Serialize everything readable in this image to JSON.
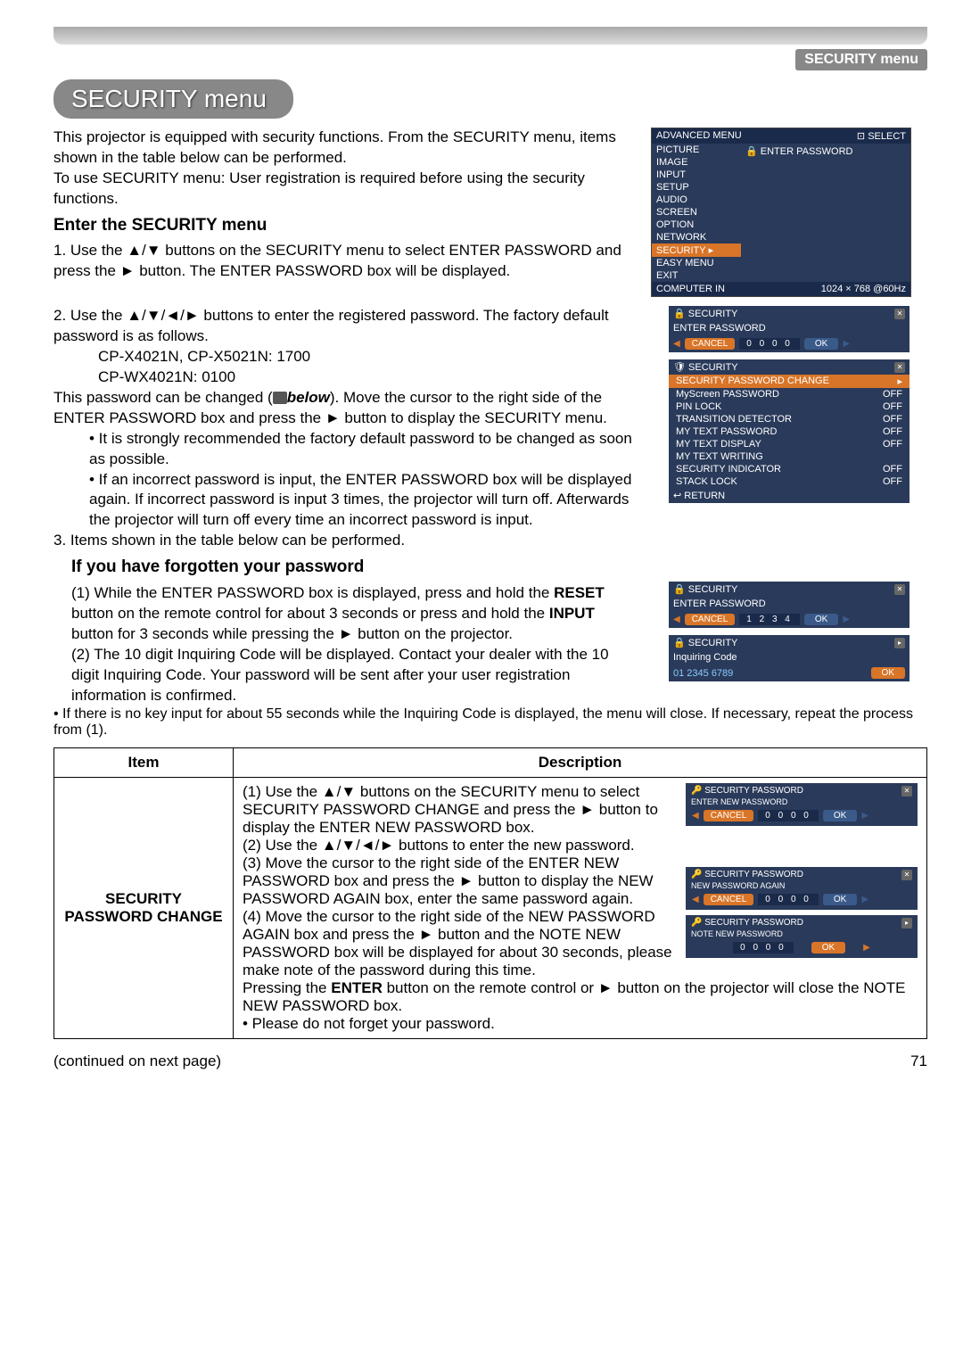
{
  "header": {
    "breadcrumb": "SECURITY menu",
    "title": "SECURITY menu"
  },
  "intro": {
    "p1": "This projector is equipped with security functions. From the SECURITY menu, items shown in the table below can be performed.",
    "p2": "To use SECURITY menu: User registration is required before using the security functions."
  },
  "enter": {
    "heading": "Enter the SECURITY menu",
    "step1": "1. Use the ▲/▼ buttons on the SECURITY menu to select ENTER PASSWORD and press the ► button. The ENTER PASSWORD box will be displayed.",
    "step2": "2. Use the ▲/▼/◄/► buttons to enter the registered password. The factory default password is as follows.",
    "pw1": "CP-X4021N, CP-X5021N: 1700",
    "pw2": "CP-WX4021N: 0100",
    "below_pre": " This password can be changed (",
    "below_link": "below",
    "below_post": "). Move the cursor to the right side of the ENTER PASSWORD box and press the ► button to display the SECURITY menu.",
    "bullet1": "• It is strongly recommended the factory default password to be changed as soon as possible.",
    "bullet2": "• If an incorrect password is input, the ENTER PASSWORD box will be displayed again. If incorrect password is input 3 times, the projector will turn off. Afterwards the projector will turn off every time an incorrect password is input.",
    "step3": "3. Items shown in the table below can be performed."
  },
  "forgot": {
    "heading": "If you have forgotten your password",
    "s1_pre": "(1) While the ENTER PASSWORD box is displayed, press and hold the ",
    "reset": "RESET",
    "s1_mid": " button on the remote control for about 3 seconds or press and hold the ",
    "input": "INPUT",
    "s1_post": " button for 3 seconds while pressing the ► button on the projector.",
    "s2": "(2) The 10 digit Inquiring Code will be displayed. Contact your dealer with the 10 digit Inquiring Code. Your password will be sent after your user registration information is confirmed.",
    "note": "• If there is no key input for about 55 seconds while the Inquiring Code is displayed, the menu will close. If necessary, repeat the process from (1)."
  },
  "osd_main": {
    "adv": "ADVANCED MENU",
    "select": "SELECT",
    "items": [
      "PICTURE",
      "IMAGE",
      "INPUT",
      "SETUP",
      "AUDIO",
      "SCREEN",
      "OPTION",
      "NETWORK",
      "SECURITY",
      "EASY MENU",
      "EXIT"
    ],
    "right_label": "ENTER PASSWORD",
    "footer_left": "COMPUTER IN",
    "footer_right": "1024 × 768 @60Hz"
  },
  "osd_enter1": {
    "title": "SECURITY",
    "sub": "ENTER PASSWORD",
    "cancel": "CANCEL",
    "digits": "0 0 0 0",
    "ok": "OK"
  },
  "osd_list": {
    "title": "SECURITY",
    "hl": "SECURITY PASSWORD CHANGE",
    "rows": [
      {
        "label": "MyScreen PASSWORD",
        "val": "OFF"
      },
      {
        "label": "PIN LOCK",
        "val": "OFF"
      },
      {
        "label": "TRANSITION DETECTOR",
        "val": "OFF"
      },
      {
        "label": "MY TEXT PASSWORD",
        "val": "OFF"
      },
      {
        "label": "MY TEXT DISPLAY",
        "val": "OFF"
      },
      {
        "label": "MY TEXT WRITING",
        "val": ""
      },
      {
        "label": "SECURITY INDICATOR",
        "val": "OFF"
      },
      {
        "label": "STACK LOCK",
        "val": "OFF"
      }
    ],
    "return": "RETURN"
  },
  "osd_enter2": {
    "title": "SECURITY",
    "sub": "ENTER PASSWORD",
    "cancel": "CANCEL",
    "digits": "1 2 3 4",
    "ok": "OK"
  },
  "osd_inq": {
    "title": "SECURITY",
    "sub": "Inquiring Code",
    "code": "01 2345 6789",
    "ok": "OK"
  },
  "table": {
    "h1": "Item",
    "h2": "Description",
    "item": "SECURITY PASSWORD CHANGE",
    "d1": "(1) Use the ▲/▼ buttons on the SECURITY menu to select SECURITY PASSWORD CHANGE and press the ► button to display the ENTER NEW PASSWORD box.",
    "d2": "(2) Use the ▲/▼/◄/► buttons to enter the new password.",
    "d3": "(3) Move the cursor to the right side of the ENTER NEW PASSWORD box and press the ► button to display the NEW PASSWORD AGAIN box, enter the same password again.",
    "d4_pre": "(4) Move the cursor to the right side of the NEW PASSWORD AGAIN box and press the ► button and the NOTE NEW PASSWORD box will be displayed for about 30 seconds, please make note of the password during this time.",
    "d4_post": "Pressing the ENTER button on the remote control or ► button on the projector will close the NOTE NEW PASSWORD box.",
    "d5": "• Please do not forget your password.",
    "enter_bold": "ENTER"
  },
  "table_osd1": {
    "title": "SECURITY PASSWORD",
    "sub": "ENTER NEW PASSWORD",
    "cancel": "CANCEL",
    "digits": "0 0 0 0",
    "ok": "OK"
  },
  "table_osd2": {
    "title": "SECURITY PASSWORD",
    "sub": "NEW PASSWORD AGAIN",
    "cancel": "CANCEL",
    "digits": "0 0 0 0",
    "ok": "OK"
  },
  "table_osd3": {
    "title": "SECURITY PASSWORD",
    "sub": "NOTE NEW PASSWORD",
    "digits": "0 0 0 0",
    "ok": "OK"
  },
  "footer": {
    "cont": "(continued on next page)",
    "page": "71"
  }
}
